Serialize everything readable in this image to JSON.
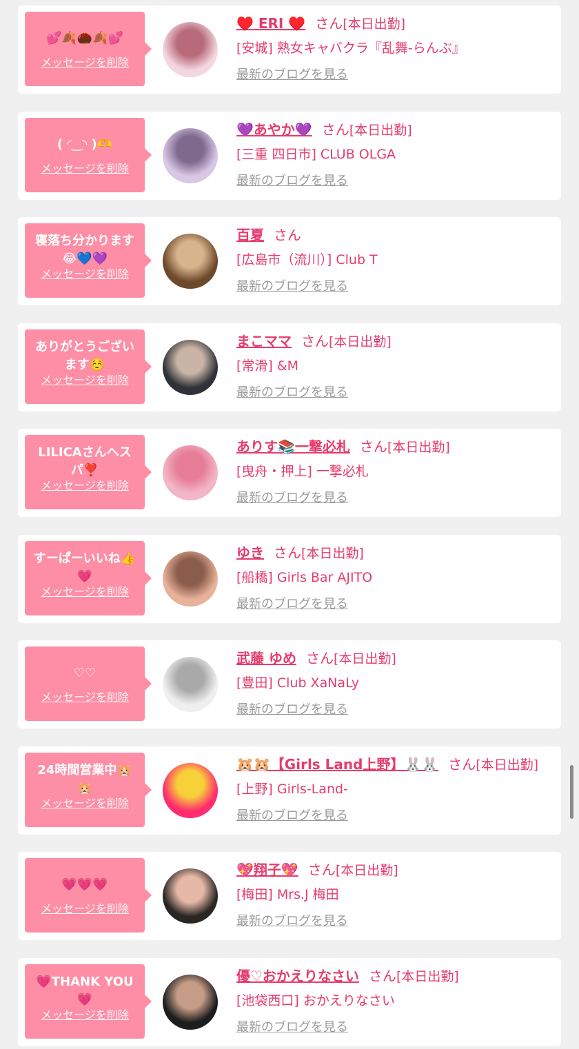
{
  "delete_label": "メッセージを削除",
  "blog_label": "最新のブログを見る",
  "san_label": "さん",
  "colors": {
    "page_bg": "#f0f0f0",
    "card_bg": "#ffffff",
    "bubble_bg": "#fd8ea5",
    "accent": "#e73b6c",
    "link_gray": "#9a9a9a"
  },
  "items": [
    {
      "message": "💕🍂🌰🍂💕",
      "name": "♥️ ERI ♥️",
      "status": "[本日出勤]",
      "shop": "[安城] 熟女キャバクラ『乱舞-らんぶ』",
      "avatar_colors": [
        "#f3d6df",
        "#b86a7a"
      ]
    },
    {
      "message": "( ◜‿◝ )🫶",
      "name": "💜あやか💜",
      "status": "[本日出勤]",
      "shop": "[三重 四日市] CLUB OLGA",
      "avatar_colors": [
        "#d9c7e6",
        "#7f6a8e"
      ]
    },
    {
      "message": "寝落ち分かります\n😂💙💜",
      "name": "百夏",
      "status": "",
      "shop": "[広島市（流川）] Club T",
      "avatar_colors": [
        "#6e4a2c",
        "#d8b48c"
      ]
    },
    {
      "message": "ありがとうござい\nます☺️",
      "name": "まこママ",
      "status": "[本日出勤]",
      "shop": "[常滑] &M",
      "avatar_colors": [
        "#2f3238",
        "#c9b4a6"
      ]
    },
    {
      "message": "LILICAさんへス\nパ❣️",
      "name": "ありす📚一撃必札",
      "status": "[本日出勤]",
      "shop": "[曳舟・押上] 一撃必札",
      "avatar_colors": [
        "#f2b6c6",
        "#e67c96"
      ]
    },
    {
      "message": "すーぱーいいね👍\n💗",
      "name": "ゆき",
      "status": "[本日出勤]",
      "shop": "[船橋] Girls Bar AJITO",
      "avatar_colors": [
        "#e8b19a",
        "#8a5c4a"
      ]
    },
    {
      "message": "♡♡",
      "name": "武藤 ゆめ",
      "status": "[本日出勤]",
      "shop": "[豊田] Club XaNaLy",
      "avatar_colors": [
        "#efefef",
        "#a9a9a9"
      ]
    },
    {
      "message": "24時間営業中🐹\n🐹",
      "name": "🐹🐹【Girls Land上野】🐰🐰",
      "status": "[本日出勤]",
      "shop": "[上野] Girls-Land-",
      "avatar_colors": [
        "#ff2c6e",
        "#f7d13a"
      ]
    },
    {
      "message": "💗💗💗",
      "name": "💖翔子💖",
      "status": "[本日出勤]",
      "shop": "[梅田] Mrs.J 梅田",
      "avatar_colors": [
        "#2a2624",
        "#e6b8a6"
      ]
    },
    {
      "message": "💗THANK YOU💗",
      "name": "優♡おかえりなさい",
      "status": "[本日出勤]",
      "shop": "[池袋西口] おかえりなさい",
      "avatar_colors": [
        "#1d1c1e",
        "#c59c86"
      ]
    }
  ]
}
